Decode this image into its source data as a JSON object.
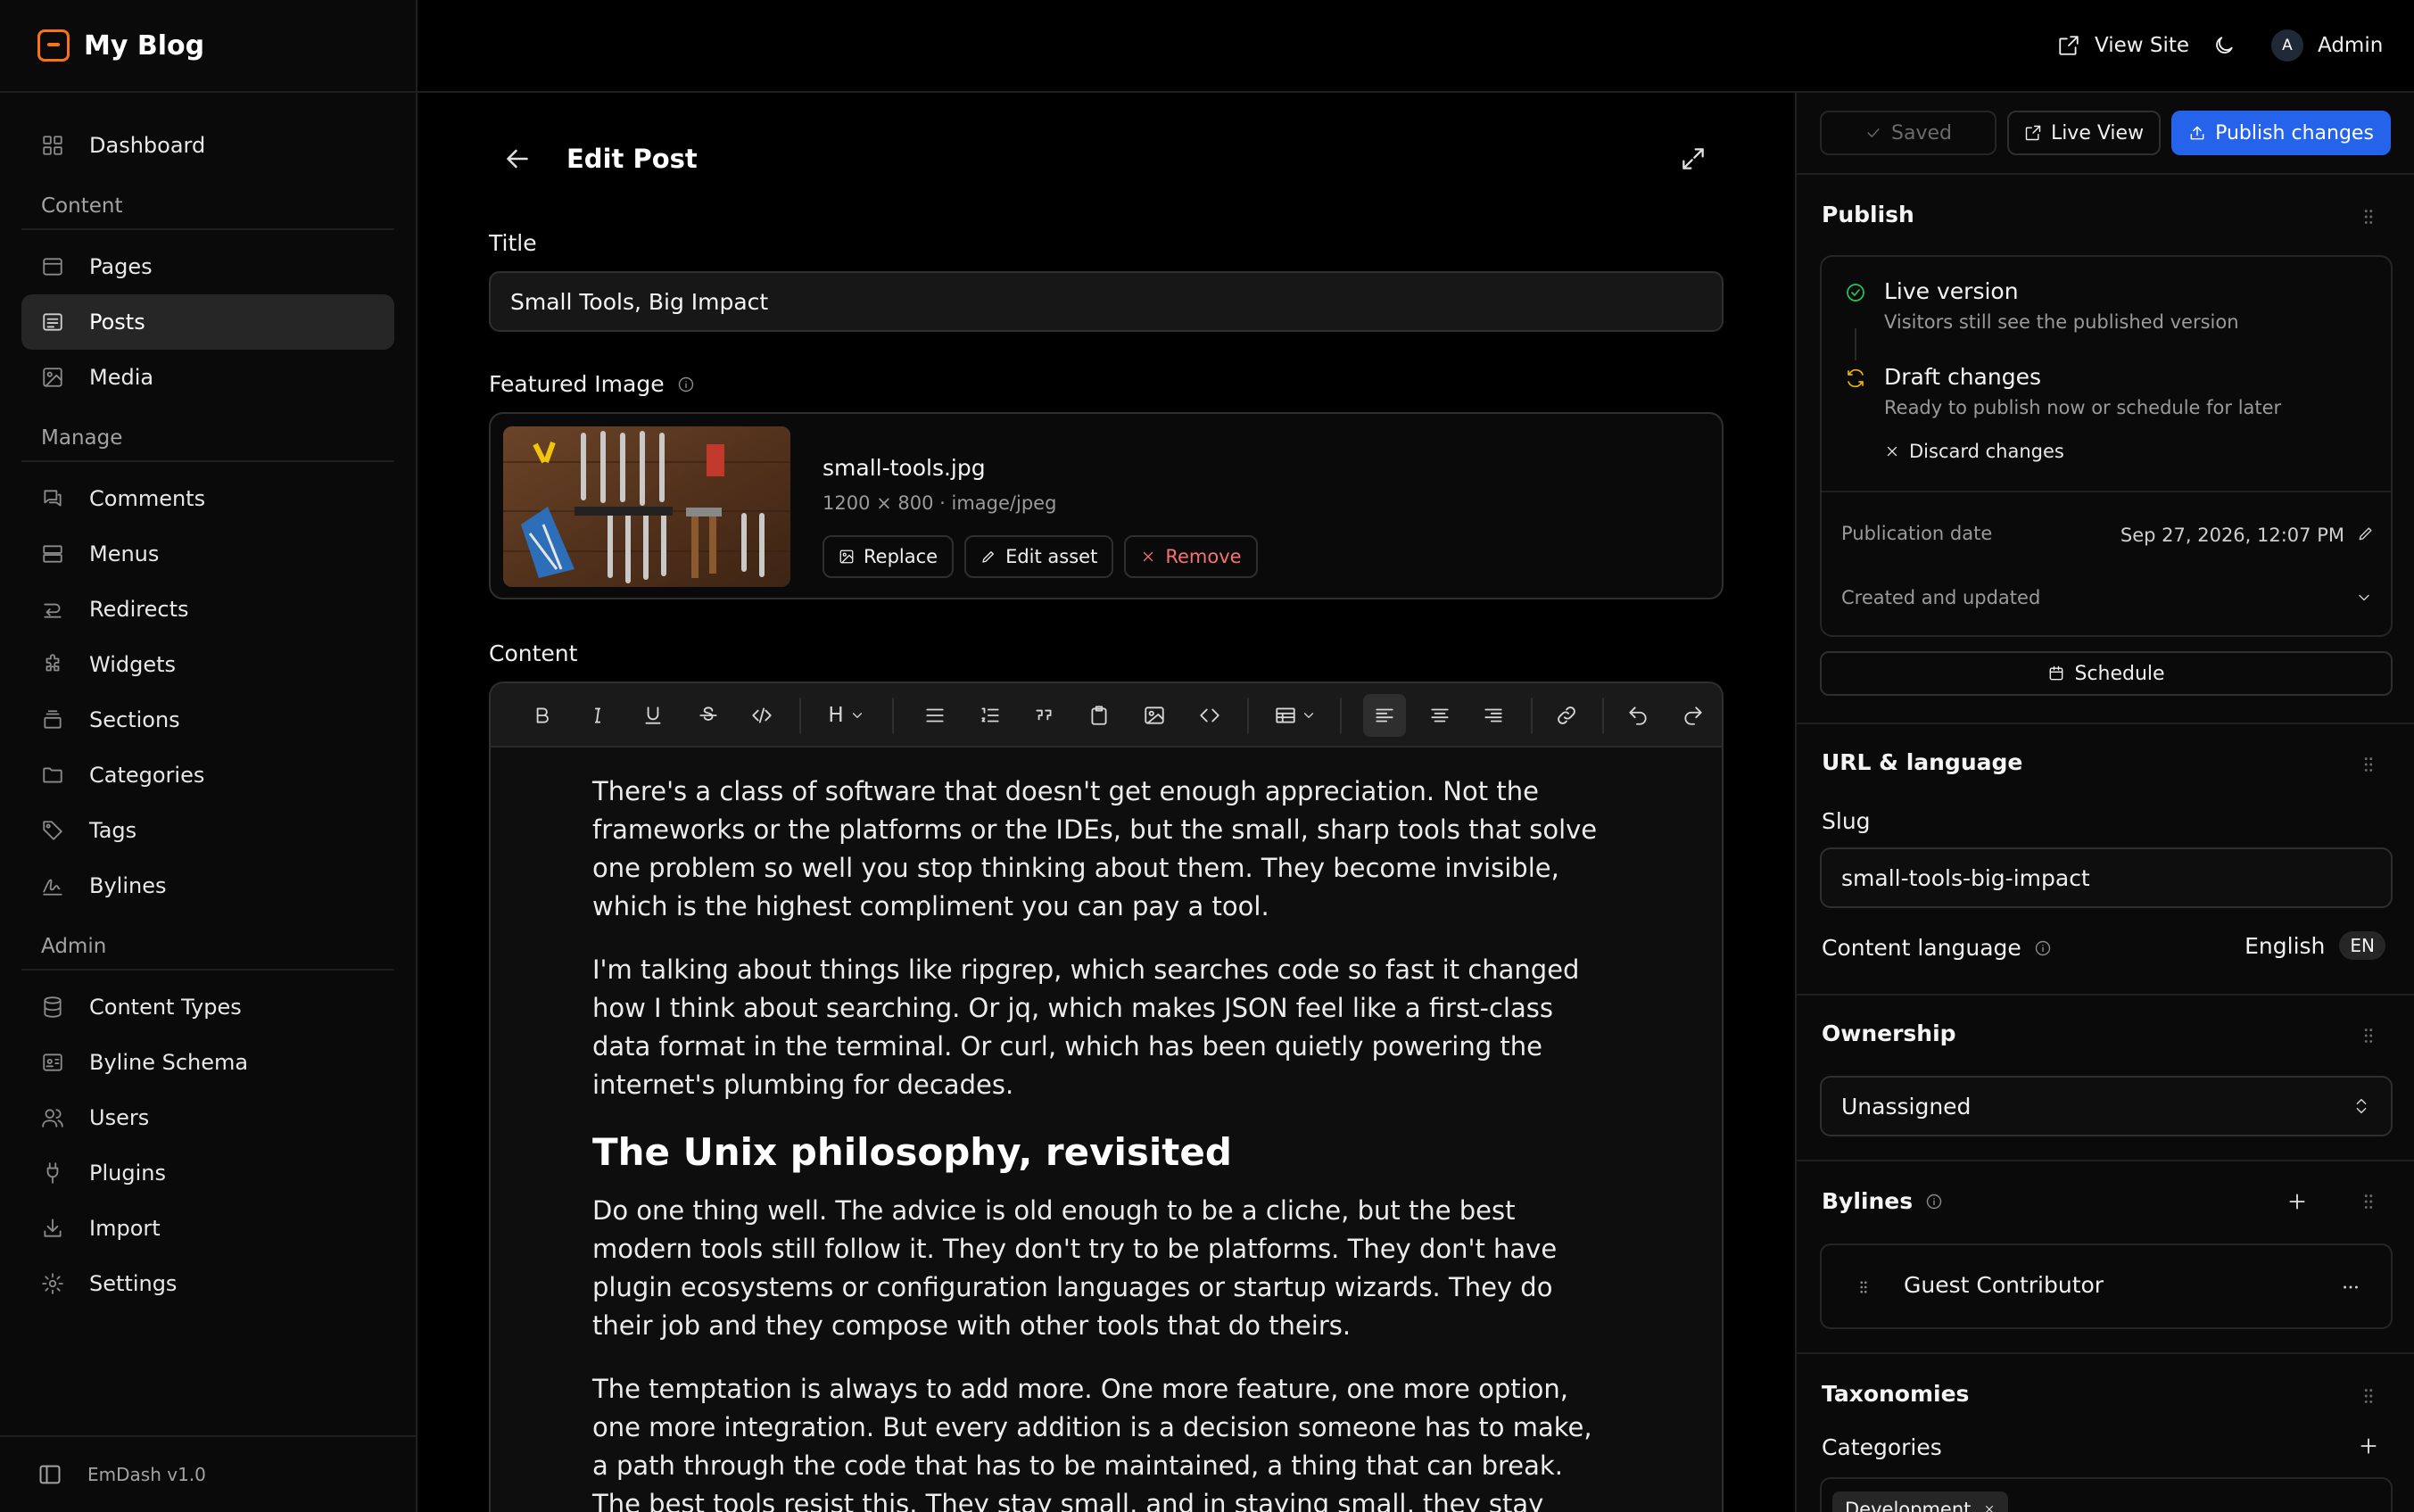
{
  "brand": {
    "name": "My Blog",
    "accent": "#f97316"
  },
  "sidebar": {
    "items": [
      {
        "label": "Dashboard"
      }
    ],
    "sections": {
      "content": "Content",
      "manage": "Manage",
      "admin": "Admin"
    },
    "content_items": [
      {
        "label": "Pages"
      },
      {
        "label": "Posts"
      },
      {
        "label": "Media"
      }
    ],
    "manage_items": [
      {
        "label": "Comments"
      },
      {
        "label": "Menus"
      },
      {
        "label": "Redirects"
      },
      {
        "label": "Widgets"
      },
      {
        "label": "Sections"
      },
      {
        "label": "Categories"
      },
      {
        "label": "Tags"
      },
      {
        "label": "Bylines"
      }
    ],
    "admin_items": [
      {
        "label": "Content Types"
      },
      {
        "label": "Byline Schema"
      },
      {
        "label": "Users"
      },
      {
        "label": "Plugins"
      },
      {
        "label": "Import"
      },
      {
        "label": "Settings"
      }
    ],
    "active": "Posts",
    "version": "EmDash v1.0"
  },
  "topbar": {
    "view_site": "View Site",
    "avatar_initial": "A",
    "user": "Admin"
  },
  "editor": {
    "page_title": "Edit Post",
    "title_label": "Title",
    "title_value": "Small Tools, Big Impact",
    "featured_label": "Featured Image",
    "image": {
      "name": "small-tools.jpg",
      "meta": "1200 × 800 · image/jpeg",
      "replace": "Replace",
      "edit": "Edit asset",
      "remove": "Remove"
    },
    "content_label": "Content",
    "heading_button": "H",
    "body": {
      "p1": "There's a class of software that doesn't get enough appreciation. Not the frameworks or the platforms or the IDEs, but the small, sharp tools that solve one problem so well you stop thinking about them. They become invisible, which is the highest compliment you can pay a tool.",
      "p2": "I'm talking about things like ripgrep, which searches code so fast it changed how I think about searching. Or jq, which makes JSON feel like a first-class data format in the terminal. Or curl, which has been quietly powering the internet's plumbing for decades.",
      "h2": "The Unix philosophy, revisited",
      "p3": "Do one thing well. The advice is old enough to be a cliche, but the best modern tools still follow it. They don't try to be platforms. They don't have plugin ecosystems or configuration languages or startup wizards. They do their job and they compose with other tools that do theirs.",
      "p4": "The temptation is always to add more. One more feature, one more option, one more integration. But every addition is a decision someone has to make, a path through the code that has to be maintained, a thing that can break. The best tools resist this. They stay small, and in staying small, they stay reliable."
    }
  },
  "panel": {
    "saved": "Saved",
    "live_view": "Live View",
    "publish": "Publish changes",
    "primary_color": "#2563eb",
    "publish_title": "Publish",
    "live_title": "Live version",
    "live_sub": "Visitors still see the published version",
    "draft_title": "Draft changes",
    "draft_sub": "Ready to publish now or schedule for later",
    "discard": "Discard changes",
    "pub_date_label": "Publication date",
    "pub_date_value": "Sep 27, 2026, 12:07 PM",
    "created_label": "Created and updated",
    "schedule": "Schedule",
    "url_title": "URL & language",
    "slug_label": "Slug",
    "slug_value": "small-tools-big-impact",
    "lang_label": "Content language",
    "lang_value": "English",
    "lang_code": "EN",
    "ownership_title": "Ownership",
    "ownership_value": "Unassigned",
    "bylines_title": "Bylines",
    "byline_name": "Guest Contributor",
    "taxonomies_title": "Taxonomies",
    "categories_label": "Categories",
    "category_chip": "Development"
  }
}
